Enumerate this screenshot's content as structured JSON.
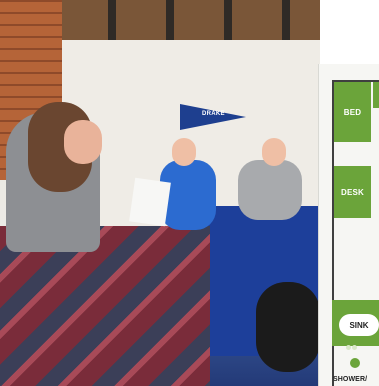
{
  "photo": {
    "pennant_text": "DRAKE"
  },
  "floor_plan": {
    "zones": {
      "bed": "BED",
      "desk": "DESK",
      "sink": "SINK",
      "shower": "SHOWER/"
    },
    "colors": {
      "zone_green": "#6ba43a",
      "wall": "#3f3f3f",
      "panel_bg": "#f6f6f3"
    }
  }
}
